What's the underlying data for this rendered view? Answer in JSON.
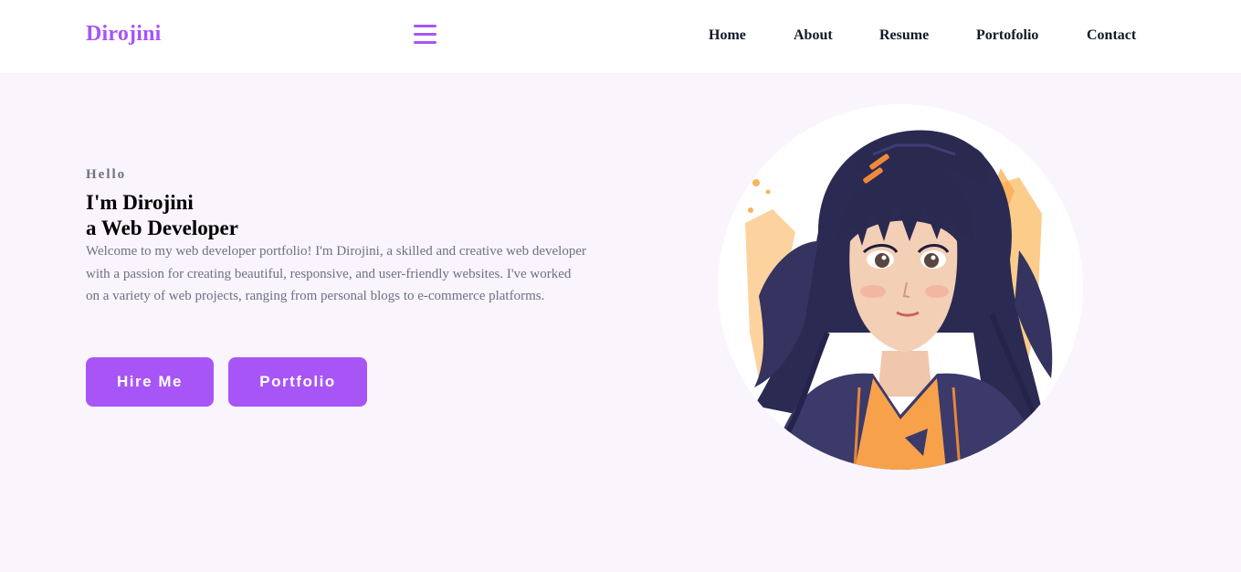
{
  "brand": {
    "name": "Dirojini"
  },
  "nav": {
    "items": [
      {
        "label": "Home"
      },
      {
        "label": "About"
      },
      {
        "label": "Resume"
      },
      {
        "label": "Portofolio"
      },
      {
        "label": "Contact"
      }
    ],
    "menu_icon": "hamburger-menu-icon"
  },
  "hero": {
    "greeting": "Hello",
    "title_line1": "I'm Dirojini",
    "title_line2": "a Web Developer",
    "description": "Welcome to my web developer portfolio! I'm Dirojini, a skilled and creative web developer with a passion for creating beautiful, responsive, and user-friendly websites. I've worked on a variety of web projects, ranging from personal blogs to e-commerce platforms.",
    "buttons": {
      "hire": "Hire Me",
      "portfolio": "Portfolio"
    },
    "image": "anime-girl-portrait-illustration"
  },
  "colors": {
    "accent": "#a855f7",
    "background": "#faf4fd",
    "nav_background": "#ffffff",
    "text_dark": "#111827",
    "text_muted": "#6b7280"
  }
}
